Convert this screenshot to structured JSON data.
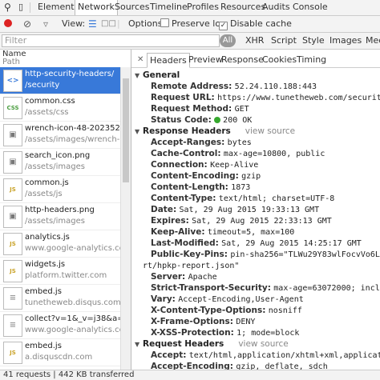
{
  "colors": {
    "selected": "#3879d9",
    "status_ok": "#36a82e",
    "record": "#d22"
  },
  "tabs": [
    "Elements",
    "Network",
    "Sources",
    "Timeline",
    "Profiles",
    "Resources",
    "Audits",
    "Console"
  ],
  "toolbar": {
    "view_label": "View:",
    "options_label": "Options:",
    "preserve_log": "Preserve log",
    "disable_cache": "Disable cache"
  },
  "filter": {
    "placeholder": "Filter",
    "all": "All",
    "types": [
      "XHR",
      "Script",
      "Style",
      "Images",
      "Med"
    ]
  },
  "list": {
    "col_name": "Name",
    "col_path": "Path",
    "rows": [
      {
        "name": "http-security-headers/",
        "path": "/security",
        "icon": "html"
      },
      {
        "name": "common.css",
        "path": "/assets/css",
        "icon": "CSS"
      },
      {
        "name": "wrench-icon-48-202352.png",
        "path": "/assets/images/wrench-icon",
        "icon": "img"
      },
      {
        "name": "search_icon.png",
        "path": "/assets/images",
        "icon": "img"
      },
      {
        "name": "common.js",
        "path": "/assets/js",
        "icon": "JS"
      },
      {
        "name": "http-headers.png",
        "path": "/assets/images",
        "icon": "img"
      },
      {
        "name": "analytics.js",
        "path": "www.google-analytics.com",
        "icon": "JS"
      },
      {
        "name": "widgets.js",
        "path": "platform.twitter.com",
        "icon": "JS"
      },
      {
        "name": "embed.js",
        "path": "tunetheweb.disqus.com",
        "icon": "doc"
      },
      {
        "name": "collect?v=1&_v=j38&a=14...",
        "path": "www.google-analytics.com",
        "icon": "doc"
      },
      {
        "name": "embed.js",
        "path": "a.disquscdn.com",
        "icon": "JS"
      }
    ]
  },
  "status": "41 requests | 442 KB transferred",
  "detail": {
    "tabs": [
      "Headers",
      "Preview",
      "Response",
      "Cookies",
      "Timing"
    ],
    "general_title": "General",
    "general": [
      {
        "k": "Remote Address:",
        "v": "52.24.110.188:443"
      },
      {
        "k": "Request URL:",
        "v": "https://www.tunetheweb.com/security/http"
      },
      {
        "k": "Request Method:",
        "v": "GET"
      },
      {
        "k": "Status Code:",
        "v": "200 OK"
      }
    ],
    "response_title": "Response Headers",
    "view_source": "view source",
    "response": [
      {
        "k": "Accept-Ranges:",
        "v": "bytes"
      },
      {
        "k": "Cache-Control:",
        "v": "max-age=10800, public"
      },
      {
        "k": "Connection:",
        "v": "Keep-Alive"
      },
      {
        "k": "Content-Encoding:",
        "v": "gzip"
      },
      {
        "k": "Content-Length:",
        "v": "1873"
      },
      {
        "k": "Content-Type:",
        "v": "text/html; charset=UTF-8"
      },
      {
        "k": "Date:",
        "v": "Sat, 29 Aug 2015 19:33:13 GMT"
      },
      {
        "k": "Expires:",
        "v": "Sat, 29 Aug 2015 22:33:13 GMT"
      },
      {
        "k": "Keep-Alive:",
        "v": "timeout=5, max=100"
      },
      {
        "k": "Last-Modified:",
        "v": "Sat, 29 Aug 2015 14:25:17 GMT"
      },
      {
        "k": "Public-Key-Pins:",
        "v": "pin-sha256=\"TLWu29Y83wlFocvVo6Lcj34h"
      },
      {
        "k": "",
        "v": "rt/hpkp-report.json\""
      },
      {
        "k": "Server:",
        "v": "Apache"
      },
      {
        "k": "Strict-Transport-Security:",
        "v": "max-age=63072000; includeSubD"
      },
      {
        "k": "Vary:",
        "v": "Accept-Encoding,User-Agent"
      },
      {
        "k": "X-Content-Type-Options:",
        "v": "nosniff"
      },
      {
        "k": "X-Frame-Options:",
        "v": "DENY"
      },
      {
        "k": "X-XSS-Protection:",
        "v": "1; mode=block"
      }
    ],
    "request_title": "Request Headers",
    "request": [
      {
        "k": "Accept:",
        "v": "text/html,application/xhtml+xml,application/"
      },
      {
        "k": "Accept-Encoding:",
        "v": "gzip, deflate, sdch"
      }
    ]
  }
}
